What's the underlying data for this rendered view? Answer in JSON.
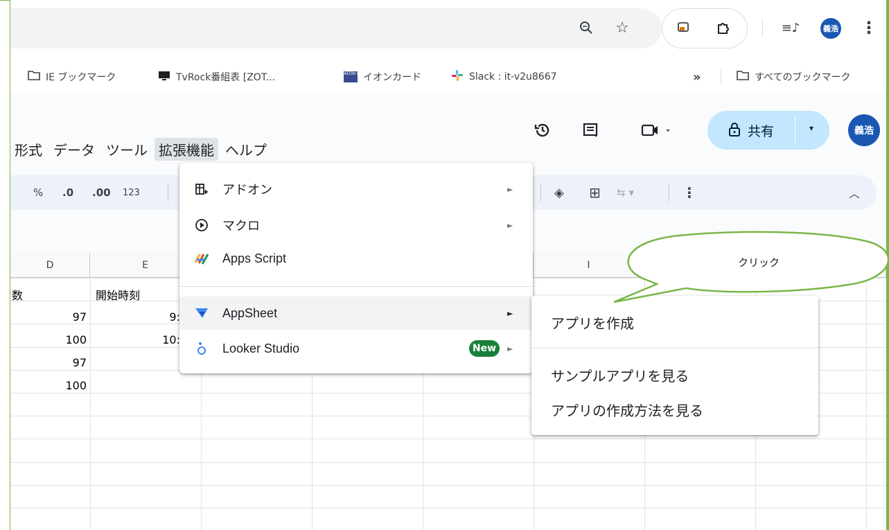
{
  "colors": {
    "accent_green": "#7ab648",
    "share_bg": "#c2e7ff",
    "avatar_blue": "#1a57b3",
    "new_badge": "#188038"
  },
  "browser": {
    "avatar_text": "義浩",
    "bookmarks": [
      {
        "label": "IE ブックマーク",
        "icon": "folder-icon"
      },
      {
        "label": "TvRock番組表 [ZOT...",
        "icon": "monitor-icon"
      },
      {
        "label": "イオンカード",
        "icon": "aeon-card-icon"
      },
      {
        "label": "Slack : it-v2u8667",
        "icon": "slack-icon"
      },
      {
        "label": "»",
        "icon": ""
      },
      {
        "label": "すべてのブックマーク",
        "icon": "folder-icon"
      }
    ]
  },
  "sheets": {
    "menu": [
      "形式",
      "データ",
      "ツール",
      "拡張機能",
      "ヘルプ"
    ],
    "active_menu": "拡張機能",
    "share_label": "共有",
    "avatar_text": "義浩",
    "toolbar": {
      "percent": "%",
      "dec_decrease": ".0",
      "dec_increase": ".00",
      "format_123": "123"
    },
    "columns": [
      "D",
      "E",
      "I"
    ],
    "cells": {
      "d_header": "数",
      "e_header": "開始時刻",
      "d_values": [
        "97",
        "100",
        "97",
        "100"
      ],
      "e_values": [
        "9:",
        "10:"
      ]
    }
  },
  "extensions_menu": {
    "items": [
      {
        "label": "アドオン",
        "icon": "addon-icon",
        "has_submenu": true
      },
      {
        "label": "マクロ",
        "icon": "macro-play-icon",
        "has_submenu": true
      },
      {
        "label": "Apps Script",
        "icon": "apps-script-icon",
        "has_submenu": false
      },
      {
        "label": "AppSheet",
        "icon": "appsheet-icon",
        "has_submenu": true
      },
      {
        "label": "Looker Studio",
        "icon": "looker-studio-icon",
        "has_submenu": true,
        "badge": "New"
      }
    ]
  },
  "appsheet_submenu": {
    "items": [
      "アプリを作成",
      "サンプルアプリを見る",
      "アプリの作成方法を見る"
    ]
  },
  "callout": {
    "text": "クリック"
  }
}
